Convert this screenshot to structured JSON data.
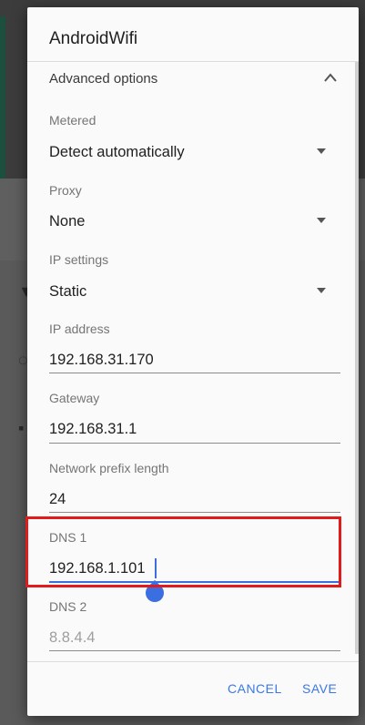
{
  "dialog": {
    "title": "AndroidWifi",
    "advanced_options_label": "Advanced options",
    "fields": {
      "metered": {
        "label": "Metered",
        "value": "Detect automatically"
      },
      "proxy": {
        "label": "Proxy",
        "value": "None"
      },
      "ip_settings": {
        "label": "IP settings",
        "value": "Static"
      },
      "ip_address": {
        "label": "IP address",
        "value": "192.168.31.170"
      },
      "gateway": {
        "label": "Gateway",
        "value": "192.168.31.1"
      },
      "prefix_length": {
        "label": "Network prefix length",
        "value": "24"
      },
      "dns1": {
        "label": "DNS 1",
        "value": "192.168.1.101"
      },
      "dns2": {
        "label": "DNS 2",
        "placeholder": "8.8.4.4"
      }
    },
    "buttons": {
      "cancel": "CANCEL",
      "save": "SAVE"
    }
  },
  "colors": {
    "accent": "#3b78e7",
    "highlight": "#e11b1b"
  }
}
